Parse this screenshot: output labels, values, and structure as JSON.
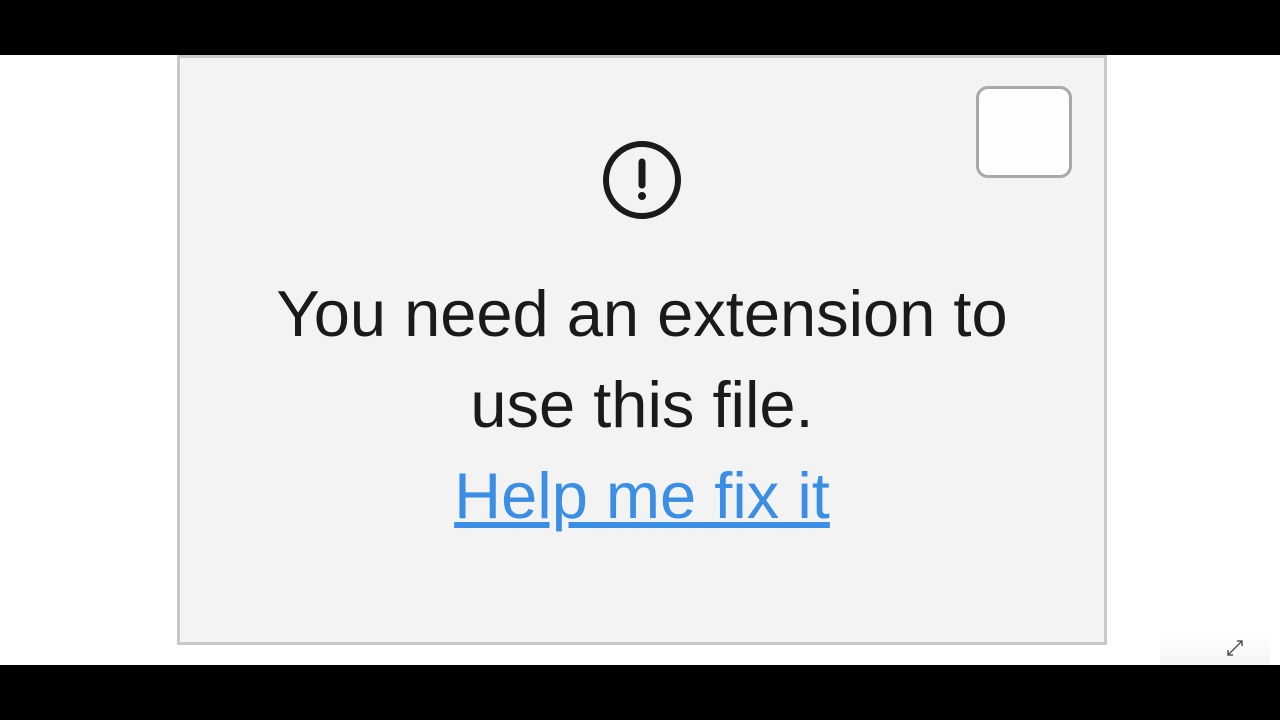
{
  "dialog": {
    "message": "You need an extension to use this file.",
    "help_link_label": "Help me fix it"
  }
}
